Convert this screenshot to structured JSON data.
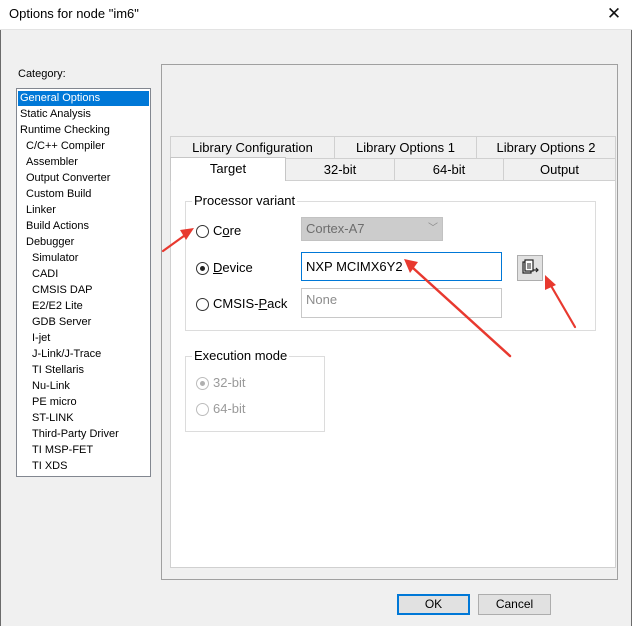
{
  "window": {
    "title": "Options for node \"im6\"",
    "close_icon": "close-icon"
  },
  "category": {
    "label": "Category:",
    "items": [
      {
        "label": "General Options",
        "selected": true
      },
      {
        "label": "Static Analysis"
      },
      {
        "label": "Runtime Checking"
      },
      {
        "label": "C/C++ Compiler"
      },
      {
        "label": "Assembler"
      },
      {
        "label": "Output Converter"
      },
      {
        "label": "Custom Build"
      },
      {
        "label": "Linker"
      },
      {
        "label": "Build Actions"
      },
      {
        "label": "Debugger"
      },
      {
        "label": "Simulator"
      },
      {
        "label": "CADI"
      },
      {
        "label": "CMSIS DAP"
      },
      {
        "label": "E2/E2 Lite"
      },
      {
        "label": "GDB Server"
      },
      {
        "label": "I-jet"
      },
      {
        "label": "J-Link/J-Trace"
      },
      {
        "label": "TI Stellaris"
      },
      {
        "label": "Nu-Link"
      },
      {
        "label": "PE micro"
      },
      {
        "label": "ST-LINK"
      },
      {
        "label": "Third-Party Driver"
      },
      {
        "label": "TI MSP-FET"
      },
      {
        "label": "TI XDS"
      }
    ]
  },
  "tabs": {
    "row1": [
      "Library Configuration",
      "Library Options 1",
      "Library Options 2"
    ],
    "row2": [
      "Target",
      "32-bit",
      "64-bit",
      "Output"
    ],
    "active": "Target"
  },
  "processor_variant": {
    "title": "Processor variant",
    "core": {
      "label_pre": "C",
      "label_ul": "o",
      "label_post": "re",
      "value": "Cortex-A7"
    },
    "device": {
      "label_pre": "",
      "label_ul": "D",
      "label_post": "evice",
      "value": "NXP MCIMX6Y2",
      "selected": true
    },
    "cmsis": {
      "label_pre": "CMSIS-",
      "label_ul": "P",
      "label_post": "ack",
      "value": "None"
    }
  },
  "execution_mode": {
    "title": "Execution mode",
    "option_32": "32-bit",
    "option_64": "64-bit",
    "selected": "32-bit"
  },
  "buttons": {
    "ok": "OK",
    "cancel": "Cancel"
  },
  "colors": {
    "accent": "#0078d7",
    "annotation_arrow": "#e8392f"
  }
}
